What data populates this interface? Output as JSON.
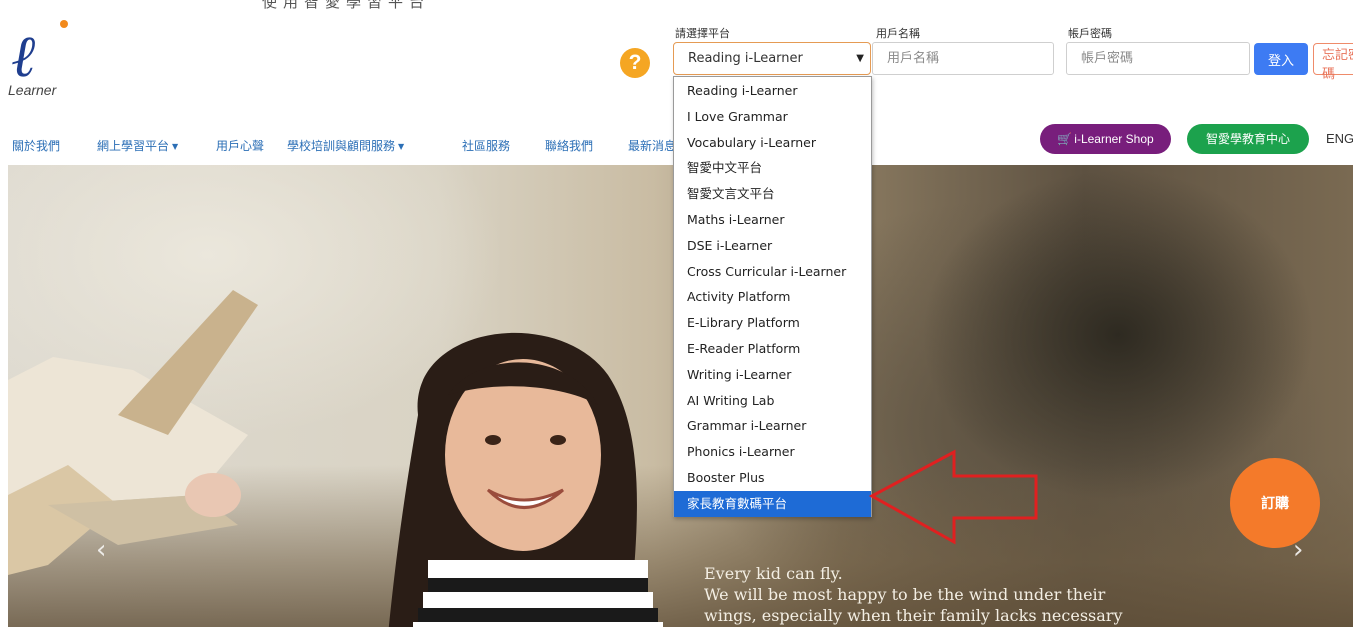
{
  "header": {
    "cropped_top_text": "使用智愛學習平台",
    "logo_word": "Learner",
    "help_icon": "?",
    "login": {
      "platform_label": "請選擇平台",
      "platform_selected": "Reading i-Learner",
      "username_label": "用戶名稱",
      "username_placeholder": "用戶名稱",
      "password_label": "帳戶密碼",
      "password_placeholder": "帳戶密碼",
      "login_button": "登入",
      "forgot_button": "忘記密碼"
    }
  },
  "nav": {
    "items": [
      "關於我們",
      "網上學習平台",
      "用戶心聲",
      "學校培訓與顧問服務",
      "社區服務",
      "聯絡我們",
      "最新消息"
    ],
    "shop_button": "i-Learner Shop",
    "edu_button": "智愛學教育中心",
    "lang_link": "ENG"
  },
  "dropdown": {
    "options": [
      "Reading i-Learner",
      "I Love Grammar",
      "Vocabulary i-Learner",
      "智愛中文平台",
      "智愛文言文平台",
      "Maths i-Learner",
      "DSE i-Learner",
      "Cross Curricular i-Learner",
      "Activity Platform",
      "E-Library Platform",
      "E-Reader Platform",
      "Writing i-Learner",
      "AI Writing Lab",
      "Grammar i-Learner",
      "Phonics i-Learner",
      "Booster Plus",
      "家長教育數碼平台"
    ],
    "highlighted": "家長教育數碼平台"
  },
  "hero": {
    "caption_line1": "Every kid can fly.",
    "caption_line2": "We will be most happy to be the wind under their",
    "caption_line3": "wings, especially when their family lacks necessary",
    "prev_icon": "‹",
    "next_icon": "›",
    "order_button": "訂購"
  },
  "colors": {
    "logo_blue": "#1f3e8f",
    "accent_orange": "#f47a2a",
    "shop_purple": "#781e7c",
    "edu_green": "#1ca24d",
    "login_blue": "#3d7bf3",
    "dropdown_highlight": "#1e6bd6",
    "annotation_red": "#e02020"
  }
}
